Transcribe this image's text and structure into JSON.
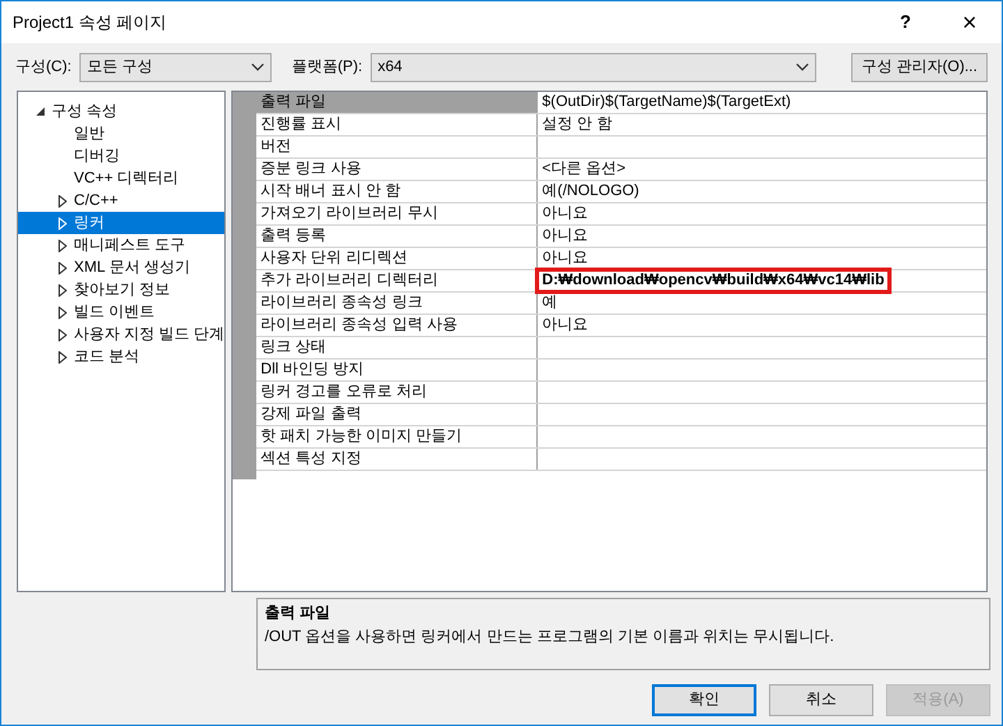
{
  "window": {
    "title": "Project1 속성 페이지",
    "help": "?",
    "close": "×"
  },
  "toolbar": {
    "config_label": "구성(C):",
    "config_value": "모든 구성",
    "platform_label": "플랫폼(P):",
    "platform_value": "x64",
    "manager_button": "구성 관리자(O)..."
  },
  "tree": [
    {
      "label": "구성 속성",
      "expanded": true,
      "selected": false,
      "children": [
        {
          "label": "일반",
          "selected": false
        },
        {
          "label": "디버깅",
          "selected": false
        },
        {
          "label": "VC++ 디렉터리",
          "selected": false
        },
        {
          "label": "C/C++",
          "expanded": false,
          "selected": false
        },
        {
          "label": "링커",
          "expanded": false,
          "selected": true
        },
        {
          "label": "매니페스트 도구",
          "expanded": false,
          "selected": false
        },
        {
          "label": "XML 문서 생성기",
          "expanded": false,
          "selected": false
        },
        {
          "label": "찾아보기 정보",
          "expanded": false,
          "selected": false
        },
        {
          "label": "빌드 이벤트",
          "expanded": false,
          "selected": false
        },
        {
          "label": "사용자 지정 빌드 단계",
          "expanded": false,
          "selected": false
        },
        {
          "label": "코드 분석",
          "expanded": false,
          "selected": false
        }
      ]
    }
  ],
  "properties": [
    {
      "name": "출력 파일",
      "value": "$(OutDir)$(TargetName)$(TargetExt)",
      "selected": true
    },
    {
      "name": "진행률 표시",
      "value": "설정 안 함",
      "selected": false
    },
    {
      "name": "버전",
      "selected": false
    },
    {
      "name": "증분 링크 사용",
      "value": "<다른 옵션>",
      "selected": false
    },
    {
      "name": "시작 배너 표시 안 함",
      "value": "예(/NOLOGO)",
      "selected": false
    },
    {
      "name": "가져오기 라이브러리 무시",
      "value": "아니요",
      "selected": false
    },
    {
      "name": "출력 등록",
      "value": "아니요",
      "selected": false
    },
    {
      "name": "사용자 단위 리디렉션",
      "value": "아니요",
      "selected": false
    },
    {
      "name": "추가 라이브러리 디렉터리",
      "value": "D:₩download₩opencv₩build₩x64₩vc14₩lib",
      "selected": false,
      "highlighted": true
    },
    {
      "name": "라이브러리 종속성 링크",
      "value": "예",
      "selected": false
    },
    {
      "name": "라이브러리 종속성 입력 사용",
      "value": "아니요",
      "selected": false
    },
    {
      "name": "링크 상태",
      "selected": false
    },
    {
      "name": "Dll 바인딩 방지",
      "selected": false
    },
    {
      "name": "링커 경고를 오류로 처리",
      "selected": false
    },
    {
      "name": "강제 파일 출력",
      "selected": false
    },
    {
      "name": "핫 패치 가능한 이미지 만들기",
      "selected": false
    },
    {
      "name": "섹션 특성 지정",
      "selected": false
    }
  ],
  "description": {
    "title": "출력 파일",
    "text": "/OUT 옵션을 사용하면 링커에서 만드는 프로그램의 기본 이름과 위치는 무시됩니다."
  },
  "buttons": [
    {
      "label": "확인",
      "kind": "default",
      "disabled": false
    },
    {
      "label": "취소",
      "kind": "normal",
      "disabled": false
    },
    {
      "label": "적용(A)",
      "kind": "normal",
      "disabled": true
    }
  ]
}
